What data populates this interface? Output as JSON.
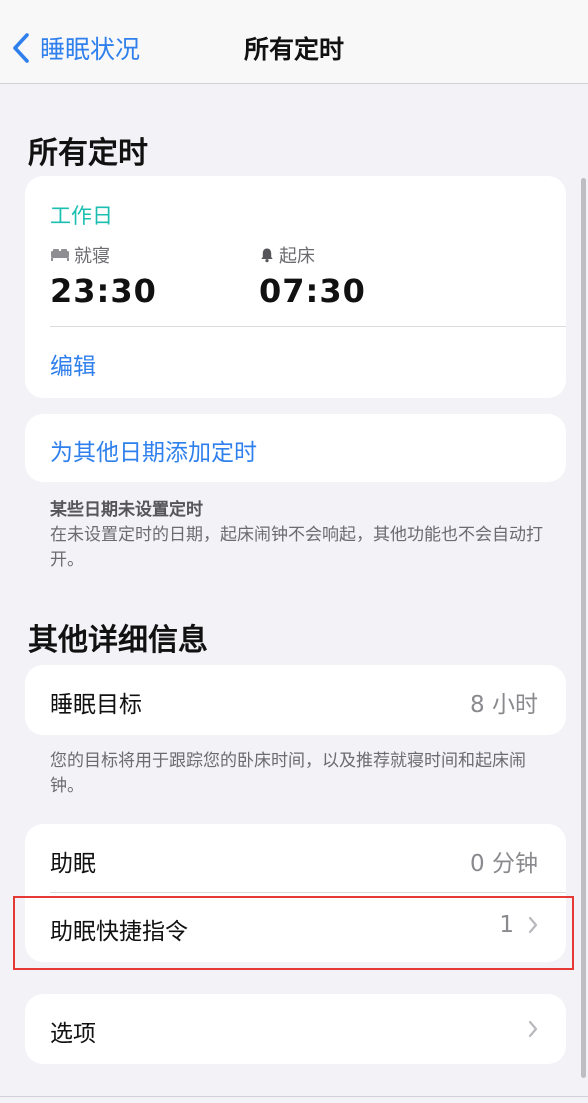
{
  "nav": {
    "back_label": "睡眠状况",
    "title": "所有定时"
  },
  "section_all": {
    "title": "所有定时"
  },
  "schedule": {
    "days": "工作日",
    "bedtime": {
      "label": "就寝",
      "time": "23:30",
      "icon": "bed-icon"
    },
    "wake": {
      "label": "起床",
      "time": "07:30",
      "icon": "bell-icon"
    },
    "edit_label": "编辑"
  },
  "add_schedule": {
    "label": "为其他日期添加定时"
  },
  "unset_note": {
    "title": "某些日期未设置定时",
    "body": "在未设置定时的日期，起床闹钟不会响起，其他功能也不会自动打开。"
  },
  "section_other": {
    "title": "其他详细信息"
  },
  "sleep_goal": {
    "label": "睡眠目标",
    "value": "8 小时"
  },
  "goal_note": "您的目标将用于跟踪您的卧床时间，以及推荐就寝时间和起床闹钟。",
  "wind_down": {
    "label": "助眠",
    "value": "0 分钟"
  },
  "wind_down_shortcuts": {
    "label": "助眠快捷指令",
    "value": "1"
  },
  "options": {
    "label": "选项"
  },
  "colors": {
    "accent_blue": "#2f80ed",
    "teal": "#1bbfb0",
    "highlight_red": "#e53935",
    "background": "#f2f2f7"
  }
}
